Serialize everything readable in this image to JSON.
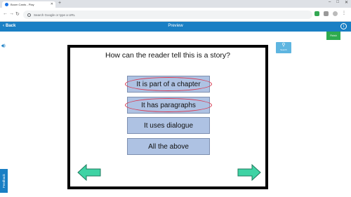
{
  "browser": {
    "tab_title": "Boom Cards - Play",
    "omnibox_placeholder": "Search Google or type a URL"
  },
  "appbar": {
    "back_label": "Back",
    "title": "Preview",
    "info_label": "i"
  },
  "finish_label": "Finish",
  "search_label": "Search",
  "card": {
    "question": "How can the reader tell this is a story?",
    "answers": [
      "It is part of a chapter",
      "It has paragraphs",
      "It uses dialogue",
      "All the above"
    ]
  },
  "feedback_label": "Feedback",
  "colors": {
    "appbar": "#1a7fc4",
    "answer_fill": "#aec2e3",
    "arrow_fill": "#3fd3a4",
    "circle_annotation": "#d9374f"
  }
}
